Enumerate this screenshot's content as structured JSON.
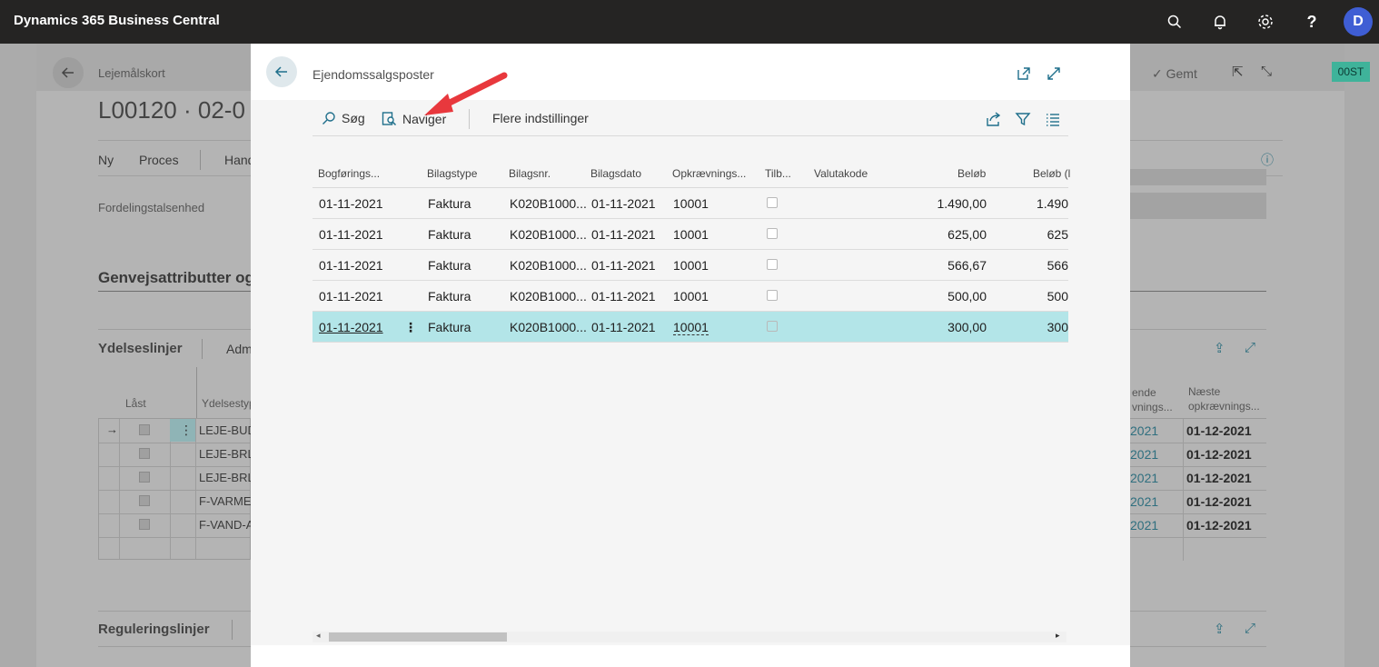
{
  "topbar": {
    "app_title": "Dynamics 365 Business Central",
    "avatar_letter": "D",
    "icons": [
      "search-icon",
      "bell-icon",
      "gear-icon",
      "help-icon"
    ]
  },
  "background_page": {
    "breadcrumb": "Lejemålskort",
    "title": "L00120 · 02-0",
    "saved_label": "Gemt",
    "badge": "00ST",
    "actions": [
      "Ny",
      "Proces",
      "Hand"
    ],
    "field_label": "Fordelingstalsenhed",
    "section_title": "Genvejsattributter og",
    "lines_tab": "Ydelseslinjer",
    "lines_tab2": "Adm",
    "col_locked": "Låst",
    "col_type": "Ydelsestype",
    "rows": [
      "LEJE-BUD",
      "LEJE-BRL-",
      "LEJE-BRL-",
      "F-VARME",
      "F-VAND-A"
    ],
    "col_right1": "ende\nvnings...",
    "col_right2_line1": "Næste",
    "col_right2_line2": "opkrævnings...",
    "right_dates_a": [
      "2021",
      "2021",
      "2021",
      "2021",
      "2021"
    ],
    "right_dates_b": [
      "01-12-2021",
      "01-12-2021",
      "01-12-2021",
      "01-12-2021",
      "01-12-2021"
    ],
    "regulation_title": "Reguleringslinjer"
  },
  "dialog": {
    "title": "Ejendomssalgsposter",
    "toolbar": {
      "search_label": "Søg",
      "navigate_label": "Naviger",
      "more_label": "Flere indstillinger"
    },
    "columns": [
      "Bogførings...",
      "Bilagstype",
      "Bilagsnr.",
      "Bilagsdato",
      "Opkrævnings...",
      "Tilb...",
      "Valutakode",
      "Beløb",
      "Beløb (l"
    ],
    "rows": [
      {
        "posting_date": "01-11-2021",
        "doc_type": "Faktura",
        "doc_no": "K020B1000...",
        "doc_date": "01-11-2021",
        "collection": "10001",
        "currency": "",
        "amount": "1.490,00",
        "amount_lcy": "1.490"
      },
      {
        "posting_date": "01-11-2021",
        "doc_type": "Faktura",
        "doc_no": "K020B1000...",
        "doc_date": "01-11-2021",
        "collection": "10001",
        "currency": "",
        "amount": "625,00",
        "amount_lcy": "625"
      },
      {
        "posting_date": "01-11-2021",
        "doc_type": "Faktura",
        "doc_no": "K020B1000...",
        "doc_date": "01-11-2021",
        "collection": "10001",
        "currency": "",
        "amount": "566,67",
        "amount_lcy": "566"
      },
      {
        "posting_date": "01-11-2021",
        "doc_type": "Faktura",
        "doc_no": "K020B1000...",
        "doc_date": "01-11-2021",
        "collection": "10001",
        "currency": "",
        "amount": "500,00",
        "amount_lcy": "500"
      },
      {
        "posting_date": "01-11-2021",
        "doc_type": "Faktura",
        "doc_no": "K020B1000...",
        "doc_date": "01-11-2021",
        "collection": "10001",
        "currency": "",
        "amount": "300,00",
        "amount_lcy": "300"
      }
    ],
    "selected_row": 4
  },
  "colors": {
    "topbar": "#252423",
    "avatar": "#3f5ed4",
    "selected_row": "#b3e5e8",
    "accent": "#1f6f8b",
    "annotation_arrow": "#e8383d"
  }
}
